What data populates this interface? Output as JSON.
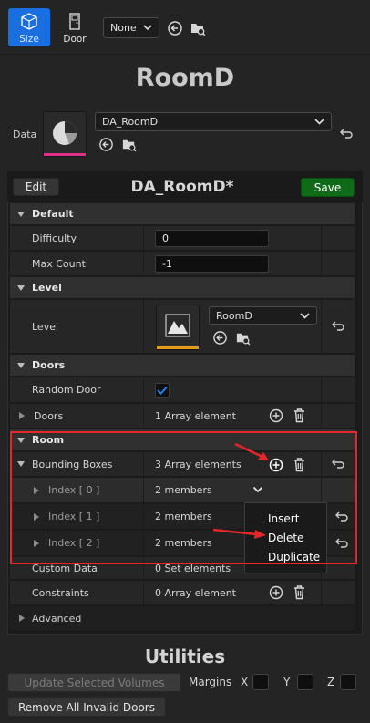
{
  "toolbar": {
    "size_label": "Size",
    "door_label": "Door",
    "filter_value": "None"
  },
  "header": {
    "title": "RoomD"
  },
  "data_row": {
    "label": "Data",
    "asset_name": "DA_RoomD"
  },
  "editor": {
    "asset_title": "DA_RoomD*",
    "edit_label": "Edit",
    "save_label": "Save"
  },
  "categories": {
    "default": "Default",
    "level": "Level",
    "doors": "Doors",
    "room": "Room",
    "advanced": "Advanced"
  },
  "props": {
    "difficulty": {
      "label": "Difficulty",
      "value": "0"
    },
    "max_count": {
      "label": "Max Count",
      "value": "-1"
    },
    "level": {
      "label": "Level",
      "asset": "RoomD"
    },
    "random_door": {
      "label": "Random Door",
      "checked": true
    },
    "doors": {
      "label": "Doors",
      "value": "1 Array element"
    },
    "bounding_boxes": {
      "label": "Bounding Boxes",
      "value": "3 Array elements"
    },
    "index0": {
      "label": "Index [ 0 ]",
      "value": "2 members"
    },
    "index1": {
      "label": "Index [ 1 ]",
      "value": "2 members"
    },
    "index2": {
      "label": "Index [ 2 ]",
      "value": "2 members"
    },
    "custom_data": {
      "label": "Custom Data",
      "value": "0 Set elements"
    },
    "constraints": {
      "label": "Constraints",
      "value": "0 Array element"
    }
  },
  "context_menu": {
    "insert": "Insert",
    "delete": "Delete",
    "duplicate": "Duplicate"
  },
  "utilities": {
    "title": "Utilities",
    "update_label": "Update Selected Volumes",
    "margins_label": "Margins",
    "x": "X",
    "y": "Y",
    "z": "Z",
    "remove_label": "Remove All Invalid Doors"
  },
  "colors": {
    "accent": "#1a6fe0",
    "save": "#0f6b17",
    "highlight": "#e5262b",
    "thumb_underline": "#e0318a",
    "level_underline": "#e59a1c"
  }
}
